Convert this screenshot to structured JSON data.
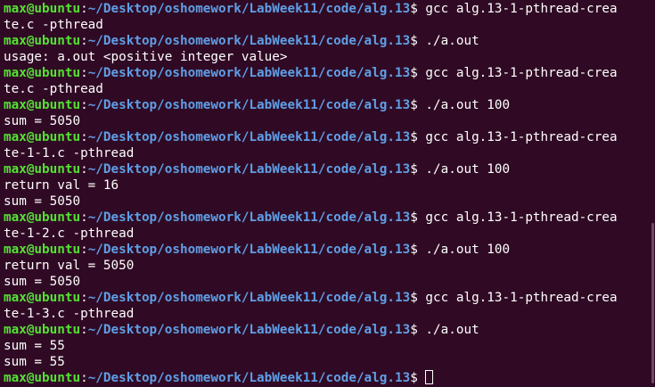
{
  "prompt": {
    "user": "max@ubuntu",
    "separator": ":",
    "path": "~/Desktop/oshomework/LabWeek11/code/alg.13",
    "symbol": "$ "
  },
  "lines": [
    {
      "type": "prompt",
      "cmd": "gcc alg.13-1-pthread-crea"
    },
    {
      "type": "output",
      "text": "te.c -pthread"
    },
    {
      "type": "prompt",
      "cmd": "./a.out"
    },
    {
      "type": "output",
      "text": "usage: a.out <positive integer value>"
    },
    {
      "type": "prompt",
      "cmd": "gcc alg.13-1-pthread-crea"
    },
    {
      "type": "output",
      "text": "te.c -pthread"
    },
    {
      "type": "prompt",
      "cmd": "./a.out 100"
    },
    {
      "type": "output",
      "text": "sum = 5050"
    },
    {
      "type": "prompt",
      "cmd": "gcc alg.13-1-pthread-crea"
    },
    {
      "type": "output",
      "text": "te-1-1.c -pthread"
    },
    {
      "type": "prompt",
      "cmd": "./a.out 100"
    },
    {
      "type": "output",
      "text": "return val = 16"
    },
    {
      "type": "output",
      "text": "sum = 5050"
    },
    {
      "type": "prompt",
      "cmd": "gcc alg.13-1-pthread-crea"
    },
    {
      "type": "output",
      "text": "te-1-2.c -pthread"
    },
    {
      "type": "prompt",
      "cmd": "./a.out 100"
    },
    {
      "type": "output",
      "text": "return val = 5050"
    },
    {
      "type": "output",
      "text": "sum = 5050"
    },
    {
      "type": "prompt",
      "cmd": "gcc alg.13-1-pthread-crea"
    },
    {
      "type": "output",
      "text": "te-1-3.c -pthread"
    },
    {
      "type": "prompt",
      "cmd": "./a.out"
    },
    {
      "type": "output",
      "text": "sum = 55"
    },
    {
      "type": "output",
      "text": "sum = 55"
    },
    {
      "type": "prompt",
      "cmd": "",
      "cursor": true
    }
  ],
  "colors": {
    "background": "#300a24",
    "user": "#55e235",
    "path": "#5f9fe6",
    "text": "#ffffff"
  }
}
